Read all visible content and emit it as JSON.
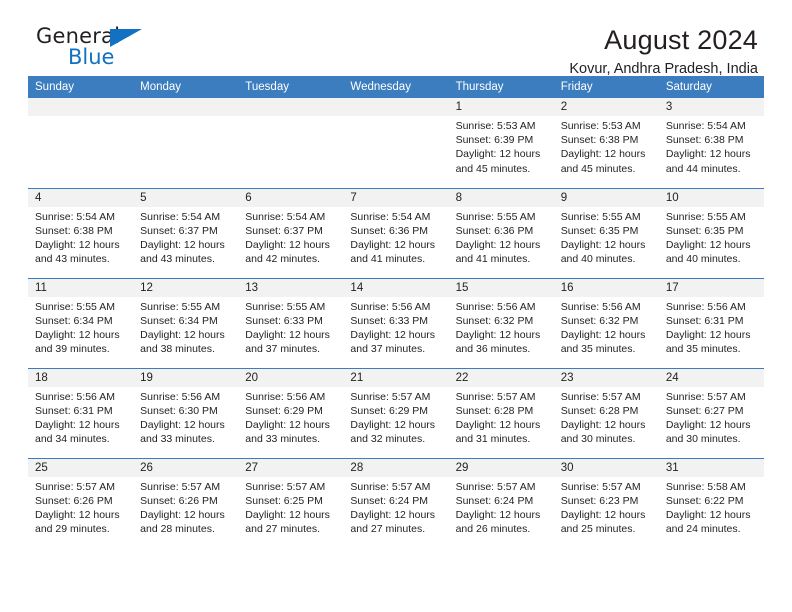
{
  "brand": {
    "name_part1": "General",
    "name_part2": "Blue",
    "triangle_icon": "triangle-icon",
    "accent_color": "#1271c0"
  },
  "header": {
    "title": "August 2024",
    "subtitle": "Kovur, Andhra Pradesh, India"
  },
  "calendar": {
    "header_bg": "#3b7dbf",
    "daynum_bg": "#f2f2f2",
    "weekday_headers": [
      "Sunday",
      "Monday",
      "Tuesday",
      "Wednesday",
      "Thursday",
      "Friday",
      "Saturday"
    ],
    "labels": {
      "sunrise": "Sunrise:",
      "sunset": "Sunset:",
      "daylight": "Daylight:"
    },
    "weeks": [
      [
        {
          "day": "",
          "empty": true
        },
        {
          "day": "",
          "empty": true
        },
        {
          "day": "",
          "empty": true
        },
        {
          "day": "",
          "empty": true
        },
        {
          "day": "1",
          "sunrise": "Sunrise: 5:53 AM",
          "sunset": "Sunset: 6:39 PM",
          "daylight_line1": "Daylight: 12 hours",
          "daylight_line2": "and 45 minutes."
        },
        {
          "day": "2",
          "sunrise": "Sunrise: 5:53 AM",
          "sunset": "Sunset: 6:38 PM",
          "daylight_line1": "Daylight: 12 hours",
          "daylight_line2": "and 45 minutes."
        },
        {
          "day": "3",
          "sunrise": "Sunrise: 5:54 AM",
          "sunset": "Sunset: 6:38 PM",
          "daylight_line1": "Daylight: 12 hours",
          "daylight_line2": "and 44 minutes."
        }
      ],
      [
        {
          "day": "4",
          "sunrise": "Sunrise: 5:54 AM",
          "sunset": "Sunset: 6:38 PM",
          "daylight_line1": "Daylight: 12 hours",
          "daylight_line2": "and 43 minutes."
        },
        {
          "day": "5",
          "sunrise": "Sunrise: 5:54 AM",
          "sunset": "Sunset: 6:37 PM",
          "daylight_line1": "Daylight: 12 hours",
          "daylight_line2": "and 43 minutes."
        },
        {
          "day": "6",
          "sunrise": "Sunrise: 5:54 AM",
          "sunset": "Sunset: 6:37 PM",
          "daylight_line1": "Daylight: 12 hours",
          "daylight_line2": "and 42 minutes."
        },
        {
          "day": "7",
          "sunrise": "Sunrise: 5:54 AM",
          "sunset": "Sunset: 6:36 PM",
          "daylight_line1": "Daylight: 12 hours",
          "daylight_line2": "and 41 minutes."
        },
        {
          "day": "8",
          "sunrise": "Sunrise: 5:55 AM",
          "sunset": "Sunset: 6:36 PM",
          "daylight_line1": "Daylight: 12 hours",
          "daylight_line2": "and 41 minutes."
        },
        {
          "day": "9",
          "sunrise": "Sunrise: 5:55 AM",
          "sunset": "Sunset: 6:35 PM",
          "daylight_line1": "Daylight: 12 hours",
          "daylight_line2": "and 40 minutes."
        },
        {
          "day": "10",
          "sunrise": "Sunrise: 5:55 AM",
          "sunset": "Sunset: 6:35 PM",
          "daylight_line1": "Daylight: 12 hours",
          "daylight_line2": "and 40 minutes."
        }
      ],
      [
        {
          "day": "11",
          "sunrise": "Sunrise: 5:55 AM",
          "sunset": "Sunset: 6:34 PM",
          "daylight_line1": "Daylight: 12 hours",
          "daylight_line2": "and 39 minutes."
        },
        {
          "day": "12",
          "sunrise": "Sunrise: 5:55 AM",
          "sunset": "Sunset: 6:34 PM",
          "daylight_line1": "Daylight: 12 hours",
          "daylight_line2": "and 38 minutes."
        },
        {
          "day": "13",
          "sunrise": "Sunrise: 5:55 AM",
          "sunset": "Sunset: 6:33 PM",
          "daylight_line1": "Daylight: 12 hours",
          "daylight_line2": "and 37 minutes."
        },
        {
          "day": "14",
          "sunrise": "Sunrise: 5:56 AM",
          "sunset": "Sunset: 6:33 PM",
          "daylight_line1": "Daylight: 12 hours",
          "daylight_line2": "and 37 minutes."
        },
        {
          "day": "15",
          "sunrise": "Sunrise: 5:56 AM",
          "sunset": "Sunset: 6:32 PM",
          "daylight_line1": "Daylight: 12 hours",
          "daylight_line2": "and 36 minutes."
        },
        {
          "day": "16",
          "sunrise": "Sunrise: 5:56 AM",
          "sunset": "Sunset: 6:32 PM",
          "daylight_line1": "Daylight: 12 hours",
          "daylight_line2": "and 35 minutes."
        },
        {
          "day": "17",
          "sunrise": "Sunrise: 5:56 AM",
          "sunset": "Sunset: 6:31 PM",
          "daylight_line1": "Daylight: 12 hours",
          "daylight_line2": "and 35 minutes."
        }
      ],
      [
        {
          "day": "18",
          "sunrise": "Sunrise: 5:56 AM",
          "sunset": "Sunset: 6:31 PM",
          "daylight_line1": "Daylight: 12 hours",
          "daylight_line2": "and 34 minutes."
        },
        {
          "day": "19",
          "sunrise": "Sunrise: 5:56 AM",
          "sunset": "Sunset: 6:30 PM",
          "daylight_line1": "Daylight: 12 hours",
          "daylight_line2": "and 33 minutes."
        },
        {
          "day": "20",
          "sunrise": "Sunrise: 5:56 AM",
          "sunset": "Sunset: 6:29 PM",
          "daylight_line1": "Daylight: 12 hours",
          "daylight_line2": "and 33 minutes."
        },
        {
          "day": "21",
          "sunrise": "Sunrise: 5:57 AM",
          "sunset": "Sunset: 6:29 PM",
          "daylight_line1": "Daylight: 12 hours",
          "daylight_line2": "and 32 minutes."
        },
        {
          "day": "22",
          "sunrise": "Sunrise: 5:57 AM",
          "sunset": "Sunset: 6:28 PM",
          "daylight_line1": "Daylight: 12 hours",
          "daylight_line2": "and 31 minutes."
        },
        {
          "day": "23",
          "sunrise": "Sunrise: 5:57 AM",
          "sunset": "Sunset: 6:28 PM",
          "daylight_line1": "Daylight: 12 hours",
          "daylight_line2": "and 30 minutes."
        },
        {
          "day": "24",
          "sunrise": "Sunrise: 5:57 AM",
          "sunset": "Sunset: 6:27 PM",
          "daylight_line1": "Daylight: 12 hours",
          "daylight_line2": "and 30 minutes."
        }
      ],
      [
        {
          "day": "25",
          "sunrise": "Sunrise: 5:57 AM",
          "sunset": "Sunset: 6:26 PM",
          "daylight_line1": "Daylight: 12 hours",
          "daylight_line2": "and 29 minutes."
        },
        {
          "day": "26",
          "sunrise": "Sunrise: 5:57 AM",
          "sunset": "Sunset: 6:26 PM",
          "daylight_line1": "Daylight: 12 hours",
          "daylight_line2": "and 28 minutes."
        },
        {
          "day": "27",
          "sunrise": "Sunrise: 5:57 AM",
          "sunset": "Sunset: 6:25 PM",
          "daylight_line1": "Daylight: 12 hours",
          "daylight_line2": "and 27 minutes."
        },
        {
          "day": "28",
          "sunrise": "Sunrise: 5:57 AM",
          "sunset": "Sunset: 6:24 PM",
          "daylight_line1": "Daylight: 12 hours",
          "daylight_line2": "and 27 minutes."
        },
        {
          "day": "29",
          "sunrise": "Sunrise: 5:57 AM",
          "sunset": "Sunset: 6:24 PM",
          "daylight_line1": "Daylight: 12 hours",
          "daylight_line2": "and 26 minutes."
        },
        {
          "day": "30",
          "sunrise": "Sunrise: 5:57 AM",
          "sunset": "Sunset: 6:23 PM",
          "daylight_line1": "Daylight: 12 hours",
          "daylight_line2": "and 25 minutes."
        },
        {
          "day": "31",
          "sunrise": "Sunrise: 5:58 AM",
          "sunset": "Sunset: 6:22 PM",
          "daylight_line1": "Daylight: 12 hours",
          "daylight_line2": "and 24 minutes."
        }
      ]
    ]
  }
}
